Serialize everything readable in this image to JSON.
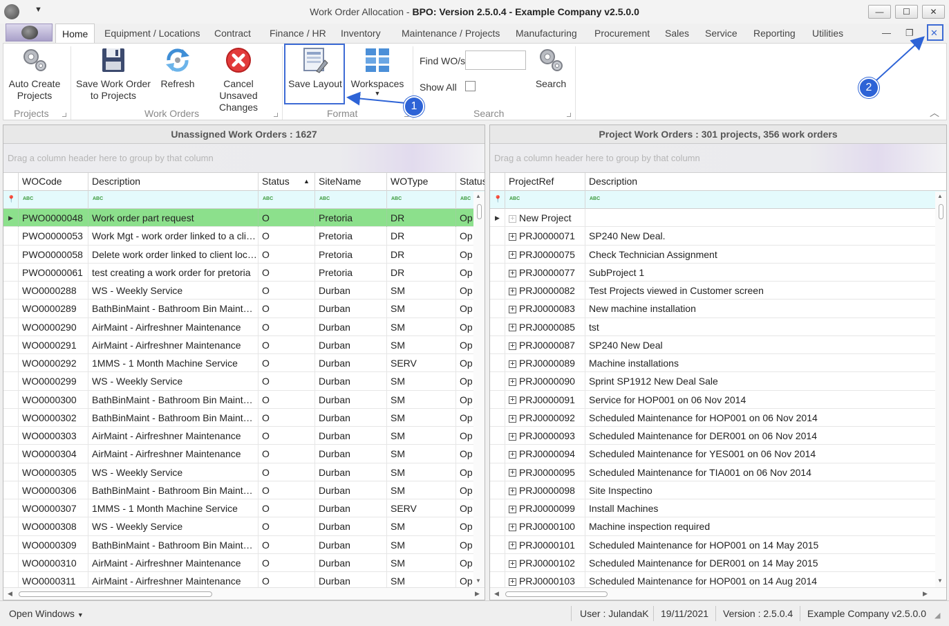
{
  "window": {
    "title_prefix": "Work Order Allocation - ",
    "title_bold": "BPO: Version 2.5.0.4 - Example Company v2.5.0.0",
    "minimize": "—",
    "maximize": "☐",
    "close": "✕"
  },
  "menu_tabs": [
    "Home",
    "Equipment / Locations",
    "Contract",
    "Finance / HR",
    "Inventory",
    "Maintenance / Projects",
    "Manufacturing",
    "Procurement",
    "Sales",
    "Service",
    "Reporting",
    "Utilities"
  ],
  "mdi_controls": {
    "minimize": "—",
    "restore": "❐",
    "close": "✕"
  },
  "ribbon": {
    "auto_create_projects": [
      "Auto Create",
      "Projects"
    ],
    "save_work_order": [
      "Save Work Order",
      "to Projects"
    ],
    "refresh": "Refresh",
    "cancel_unsaved": [
      "Cancel Unsaved",
      "Changes"
    ],
    "save_layout": "Save Layout",
    "workspaces": "Workspaces",
    "find_label": "Find WO/s",
    "find_value": "",
    "show_all_label": "Show All",
    "show_all_checked": false,
    "search": "Search",
    "groups": {
      "projects": "Projects",
      "work_orders": "Work Orders",
      "format": "Format",
      "search": "Search"
    }
  },
  "annotations": {
    "badge1": "1",
    "badge2": "2",
    "accent": "#2d63d6"
  },
  "left_panel": {
    "title": "Unassigned Work Orders : 1627",
    "group_hint": "Drag a column header here to group by that column",
    "columns": [
      "WOCode",
      "Description",
      "Status",
      "SiteName",
      "WOType",
      "Status"
    ],
    "sort_indicator": "▲",
    "rows": [
      [
        "PWO0000048",
        "Work order part request",
        "O",
        "Pretoria",
        "DR",
        "Op"
      ],
      [
        "PWO0000053",
        "Work Mgt - work order linked to a client location",
        "O",
        "Pretoria",
        "DR",
        "Op"
      ],
      [
        "PWO0000058",
        "Delete work order linked to client location",
        "O",
        "Pretoria",
        "DR",
        "Op"
      ],
      [
        "PWO0000061",
        "test creating a work order for pretoria",
        "O",
        "Pretoria",
        "DR",
        "Op"
      ],
      [
        "WO0000288",
        "WS - Weekly Service",
        "O",
        "Durban",
        "SM",
        "Op"
      ],
      [
        "WO0000289",
        "BathBinMaint - Bathroom Bin Maintenance",
        "O",
        "Durban",
        "SM",
        "Op"
      ],
      [
        "WO0000290",
        "AirMaint - Airfreshner Maintenance",
        "O",
        "Durban",
        "SM",
        "Op"
      ],
      [
        "WO0000291",
        "AirMaint - Airfreshner Maintenance",
        "O",
        "Durban",
        "SM",
        "Op"
      ],
      [
        "WO0000292",
        "1MMS - 1 Month Machine Service",
        "O",
        "Durban",
        "SERV",
        "Op"
      ],
      [
        "WO0000299",
        "WS - Weekly Service",
        "O",
        "Durban",
        "SM",
        "Op"
      ],
      [
        "WO0000300",
        "BathBinMaint - Bathroom Bin Maintenance",
        "O",
        "Durban",
        "SM",
        "Op"
      ],
      [
        "WO0000302",
        "BathBinMaint - Bathroom Bin Maintenance",
        "O",
        "Durban",
        "SM",
        "Op"
      ],
      [
        "WO0000303",
        "AirMaint - Airfreshner Maintenance",
        "O",
        "Durban",
        "SM",
        "Op"
      ],
      [
        "WO0000304",
        "AirMaint - Airfreshner Maintenance",
        "O",
        "Durban",
        "SM",
        "Op"
      ],
      [
        "WO0000305",
        "WS - Weekly Service",
        "O",
        "Durban",
        "SM",
        "Op"
      ],
      [
        "WO0000306",
        "BathBinMaint - Bathroom Bin Maintenance",
        "O",
        "Durban",
        "SM",
        "Op"
      ],
      [
        "WO0000307",
        "1MMS - 1 Month Machine Service",
        "O",
        "Durban",
        "SERV",
        "Op"
      ],
      [
        "WO0000308",
        "WS - Weekly Service",
        "O",
        "Durban",
        "SM",
        "Op"
      ],
      [
        "WO0000309",
        "BathBinMaint - Bathroom Bin Maintenance",
        "O",
        "Durban",
        "SM",
        "Op"
      ],
      [
        "WO0000310",
        "AirMaint - Airfreshner Maintenance",
        "O",
        "Durban",
        "SM",
        "Op"
      ],
      [
        "WO0000311",
        "AirMaint - Airfreshner Maintenance",
        "O",
        "Durban",
        "SM",
        "Op"
      ]
    ]
  },
  "right_panel": {
    "title": "Project Work Orders : 301 projects, 356 work orders",
    "group_hint": "Drag a column header here to group by that column",
    "columns": [
      "ProjectRef",
      "Description"
    ],
    "rows": [
      [
        "New Project",
        ""
      ],
      [
        "PRJ0000071",
        "SP240 New Deal."
      ],
      [
        "PRJ0000075",
        "Check Technician Assignment"
      ],
      [
        "PRJ0000077",
        "SubProject 1"
      ],
      [
        "PRJ0000082",
        "Test Projects viewed in Customer screen"
      ],
      [
        "PRJ0000083",
        "New machine installation"
      ],
      [
        "PRJ0000085",
        "tst"
      ],
      [
        "PRJ0000087",
        "SP240 New Deal"
      ],
      [
        "PRJ0000089",
        "Machine installations"
      ],
      [
        "PRJ0000090",
        "Sprint SP1912 New Deal Sale"
      ],
      [
        "PRJ0000091",
        "Service for HOP001 on 06 Nov 2014"
      ],
      [
        "PRJ0000092",
        "Scheduled Maintenance for HOP001 on 06 Nov 2014"
      ],
      [
        "PRJ0000093",
        "Scheduled Maintenance for DER001 on 06 Nov 2014"
      ],
      [
        "PRJ0000094",
        "Scheduled Maintenance for YES001 on 06 Nov 2014"
      ],
      [
        "PRJ0000095",
        "Scheduled Maintenance for TIA001 on 06 Nov 2014"
      ],
      [
        "PRJ0000098",
        "Site Inspectino"
      ],
      [
        "PRJ0000099",
        "Install Machines"
      ],
      [
        "PRJ0000100",
        "Machine inspection required"
      ],
      [
        "PRJ0000101",
        "Scheduled Maintenance for HOP001 on 14 May 2015"
      ],
      [
        "PRJ0000102",
        "Scheduled Maintenance for DER001 on 14 May 2015"
      ],
      [
        "PRJ0000103",
        "Scheduled Maintenance for HOP001 on 14 Aug 2014"
      ]
    ]
  },
  "statusbar": {
    "open_windows": "Open Windows",
    "user": "User : JulandaK",
    "date": "19/11/2021",
    "version": "Version : 2.5.0.4",
    "company": "Example Company v2.5.0.0"
  },
  "colors": {
    "selected_row": "#8ce08c",
    "filter_row": "#e4fafc",
    "annotation": "#2d63d6"
  }
}
